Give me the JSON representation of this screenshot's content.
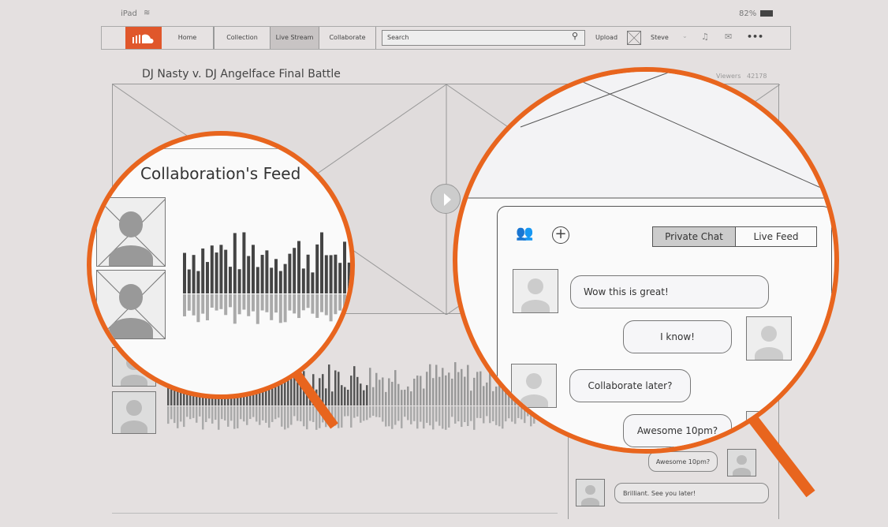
{
  "status_bar": {
    "device": "iPad",
    "battery": "82%"
  },
  "nav": {
    "home": "Home",
    "collection": "Collection",
    "live_stream": "Live Stream",
    "collaborate": "Collaborate",
    "search_placeholder": "Search",
    "upload": "Upload",
    "user": "Steve",
    "active_tab": "Live Stream"
  },
  "stream": {
    "title": "DJ Nasty v. DJ Angelface Final Battle",
    "viewers_label": "Viewers",
    "viewers_count": "42178"
  },
  "feed": {
    "title": "Collaboration's Feed"
  },
  "chat": {
    "tabs": [
      "Private Chat",
      "Live Feed"
    ],
    "active_tab": "Private Chat",
    "messages": [
      {
        "text": "Wow this is great!",
        "side": "left"
      },
      {
        "text": "I know!",
        "side": "right"
      },
      {
        "text": "Collaborate later?",
        "side": "left"
      },
      {
        "text": "Awesome 10pm?",
        "side": "right"
      },
      {
        "text": "Brilliant. See you later!",
        "side": "left"
      }
    ]
  },
  "colors": {
    "accent": "#e8651e",
    "brand": "#e0572b",
    "background": "#e4e0e0"
  }
}
